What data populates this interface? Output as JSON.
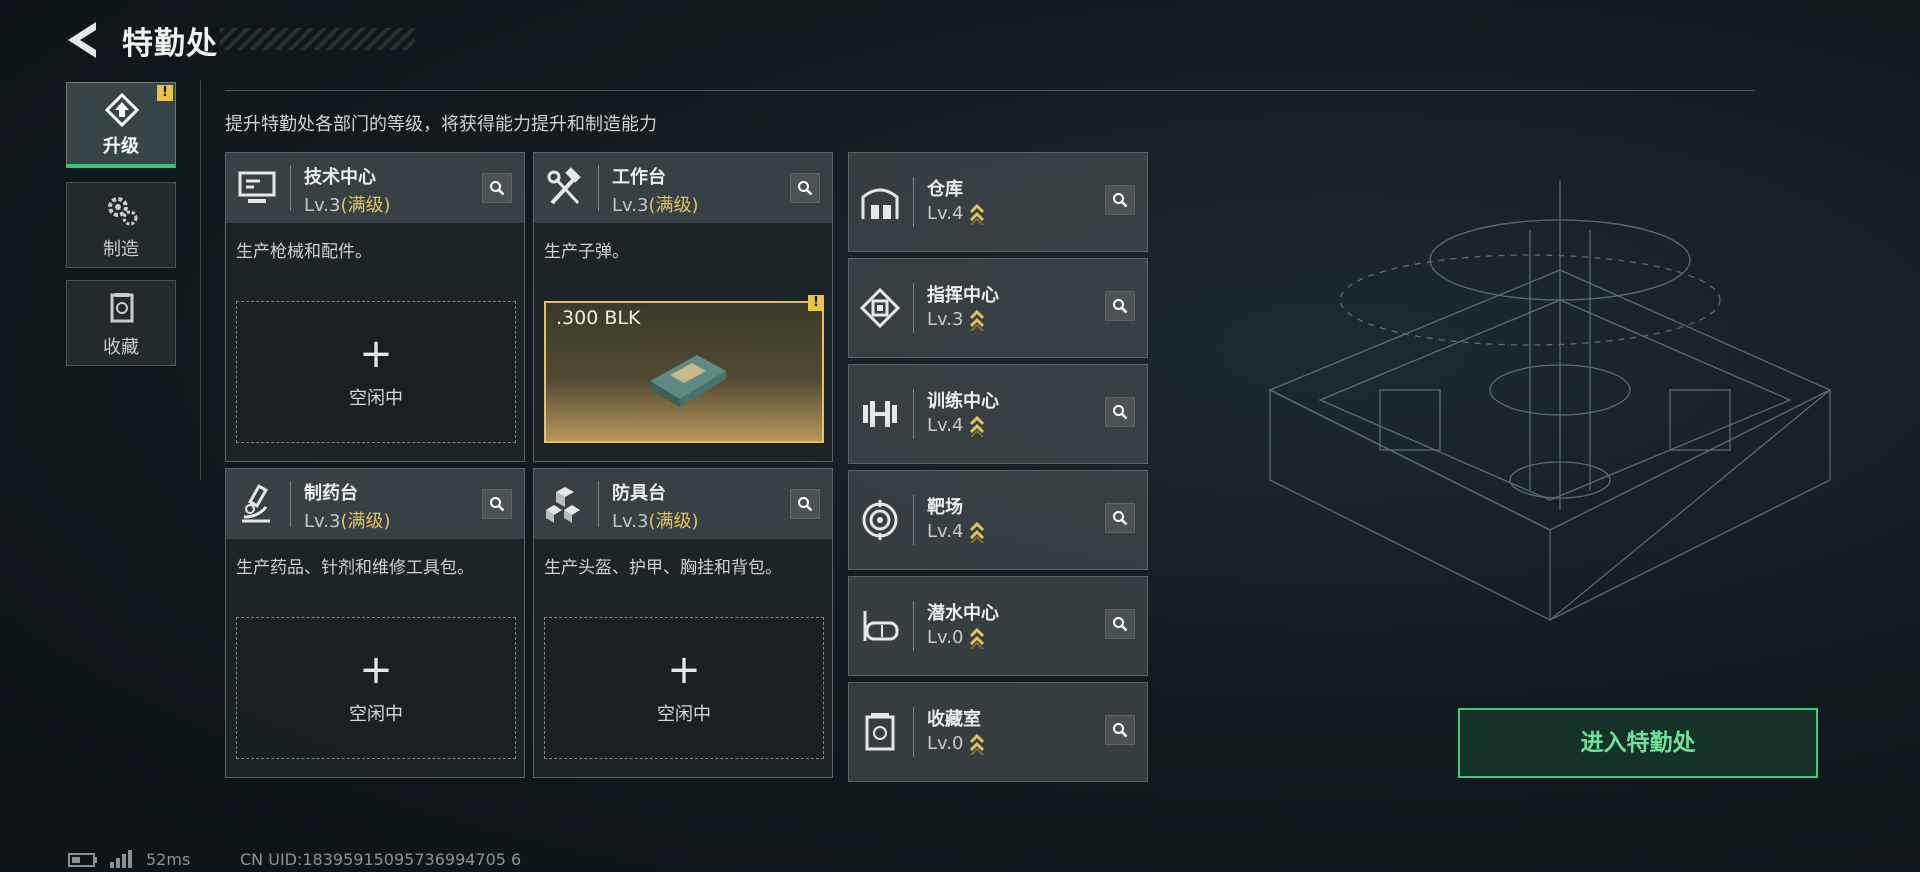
{
  "header": {
    "title": "特勤处"
  },
  "tabs": [
    {
      "label": "升级",
      "active": true,
      "alert": "!"
    },
    {
      "label": "制造",
      "active": false
    },
    {
      "label": "收藏",
      "active": false
    }
  ],
  "subtitle": "提升特勤处各部门的等级，将获得能力提升和制造能力",
  "stations": [
    {
      "name": "技术中心",
      "level": "Lv.3",
      "max": "(满级)",
      "icon": "tech-terminal-icon",
      "desc": "生产枪械和配件。",
      "slot_label": "空闲中"
    },
    {
      "name": "工作台",
      "level": "Lv.3",
      "max": "(满级)",
      "icon": "hammer-wrench-icon",
      "desc": "生产子弹。",
      "slot_item": ".300 BLK",
      "alert": "!"
    },
    {
      "name": "制药台",
      "level": "Lv.3",
      "max": "(满级)",
      "icon": "microscope-icon",
      "desc": "生产药品、针剂和维修工具包。",
      "slot_label": "空闲中"
    },
    {
      "name": "防具台",
      "level": "Lv.3",
      "max": "(满级)",
      "icon": "armor-cubes-icon",
      "desc": "生产头盔、护甲、胸挂和背包。",
      "slot_label": "空闲中"
    }
  ],
  "facilities": [
    {
      "name": "仓库",
      "level": "Lv.4",
      "icon": "warehouse-icon"
    },
    {
      "name": "指挥中心",
      "level": "Lv.3",
      "icon": "command-chip-icon"
    },
    {
      "name": "训练中心",
      "level": "Lv.4",
      "icon": "dumbbell-icon"
    },
    {
      "name": "靶场",
      "level": "Lv.4",
      "icon": "target-icon"
    },
    {
      "name": "潜水中心",
      "level": "Lv.0",
      "icon": "diving-mask-icon"
    },
    {
      "name": "收藏室",
      "level": "Lv.0",
      "icon": "collection-case-icon"
    }
  ],
  "plus_symbol": "+",
  "enter_button": "进入特勤处",
  "footer": {
    "ping": "52ms",
    "uid": "CN UID:18395915095736994705 6"
  },
  "colors": {
    "accent_green": "#3fca7a",
    "max_level": "#e3c35e",
    "upgrade_arrow": "#e3c35e"
  }
}
